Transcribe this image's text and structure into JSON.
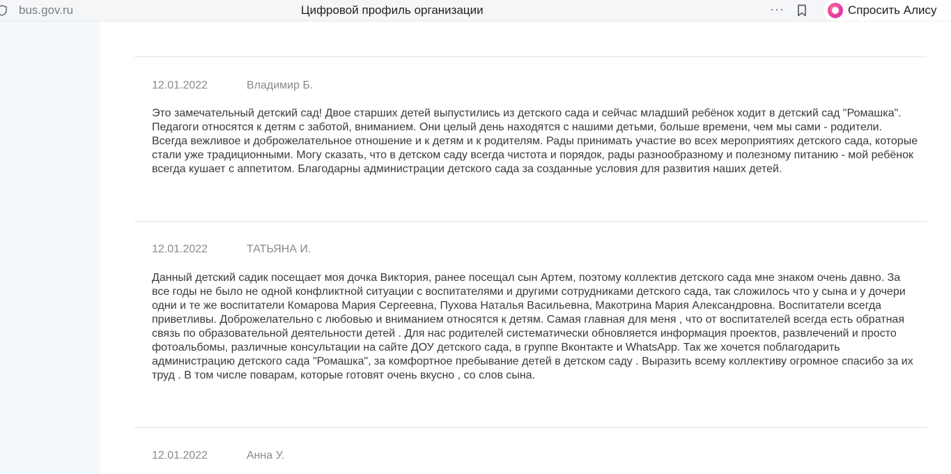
{
  "browser": {
    "address": "bus.gov.ru",
    "title": "Цифровой профиль организации",
    "alice_label": "Спросить Алису",
    "menu_dots": "···"
  },
  "reviews": [
    {
      "date": "12.01.2022",
      "author": "Владимир Б.",
      "text": "Это замечательный детский сад! Двое старших детей выпустились из детского сада и сейчас младший ребёнок ходит в детский сад \"Ромашка\". Педагоги относятся к детям с заботой, вниманием. Они целый день находятся с нашими детьми, больше времени, чем мы сами - родители. Всегда вежливое и доброжелательное отношение и к детям и к родителям. Рады принимать участие во всех мероприятиях детского сада, которые стали уже традиционными. Могу сказать, что в детском саду всегда чистота и порядок, рады разнообразному и полезному питанию - мой ребёнок всегда кушает с аппетитом. Благодарны администрации детского сада за созданные условия для развития наших детей."
    },
    {
      "date": "12.01.2022",
      "author": "ТАТЬЯНА И.",
      "text": "Данный детский садик посещает моя дочка Виктория, ранее посещал сын Артем, поэтому коллектив детского сада мне знаком очень давно. За все годы не было не одной конфликтной ситуации с воспитателями и другими сотрудниками детского сада, так сложилось что у сына и у дочери одни и те же воспитатели Комарова Мария Сергеевна, Пухова Наталья Васильевна, Макотрина Мария Александровна. Воспитатели всегда приветливы. Доброжелательно с любовью и вниманием относятся к детям. Самая главная для меня , что от воспитателей всегда есть обратная связь по образовательной деятельности детей . Для нас родителей систематически обновляется информация проектов, развлечений и просто фотоальбомы, различные консультации на сайте ДОУ детского сада, в группе Вконтакте и WhatsApp. Так же хочется поблагодарить администрацию детского сада \"Ромашка\", за комфортное пребывание детей в детском саду . Выразить всему коллективу огромное спасибо за их труд . В том числе поварам, которые готовят очень вкусно , со слов сына."
    },
    {
      "date": "12.01.2022",
      "author": "Анна У.",
      "text": ""
    }
  ]
}
